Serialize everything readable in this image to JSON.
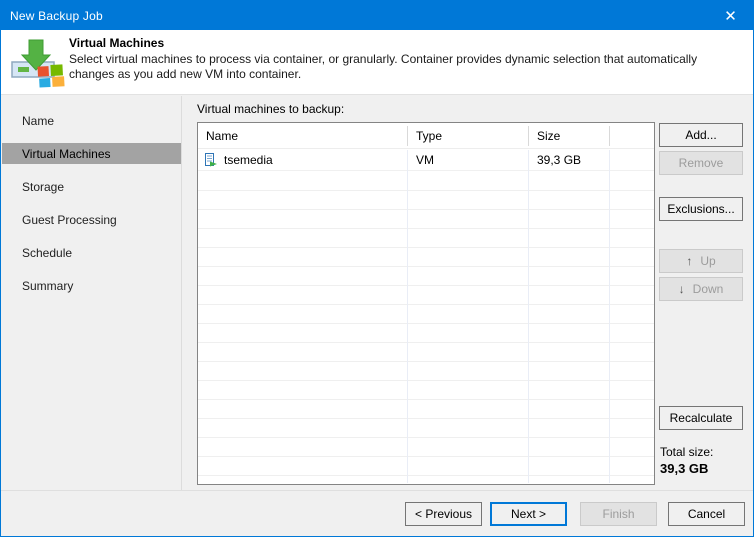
{
  "window": {
    "title": "New Backup Job",
    "close_glyph": "✕",
    "accent_color": "#0078d7"
  },
  "header": {
    "title": "Virtual Machines",
    "description": "Select virtual machines to process via container, or granularly. Container provides dynamic selection that automatically changes as you add new VM into container."
  },
  "sidebar": {
    "items": [
      {
        "label": "Name",
        "selected": false
      },
      {
        "label": "Virtual Machines",
        "selected": true
      },
      {
        "label": "Storage",
        "selected": false
      },
      {
        "label": "Guest Processing",
        "selected": false
      },
      {
        "label": "Schedule",
        "selected": false
      },
      {
        "label": "Summary",
        "selected": false
      }
    ]
  },
  "main": {
    "list_label": "Virtual machines to backup:",
    "table": {
      "columns": [
        "Name",
        "Type",
        "Size"
      ],
      "rows": [
        {
          "name": "tsemedia",
          "type": "VM",
          "size": "39,3 GB",
          "icon": "vm-icon"
        }
      ]
    },
    "side_buttons": {
      "add": "Add...",
      "remove": "Remove",
      "exclusions": "Exclusions...",
      "up": "Up",
      "down": "Down",
      "up_icon": "↑",
      "down_icon": "↓",
      "recalculate": "Recalculate"
    },
    "total": {
      "label": "Total size:",
      "value": "39,3 GB"
    }
  },
  "footer": {
    "previous": "< Previous",
    "next": "Next >",
    "finish": "Finish",
    "cancel": "Cancel"
  }
}
